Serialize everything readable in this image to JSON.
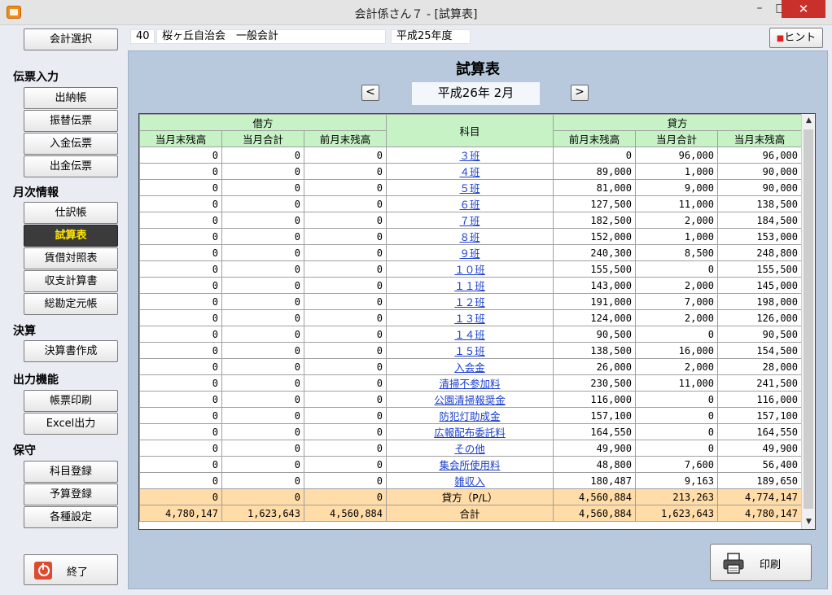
{
  "window": {
    "title": "会計係さん７ - [試算表]",
    "min": "–",
    "max": "□",
    "close": "✕"
  },
  "header": {
    "org_code": "40",
    "org_name": "桜ヶ丘自治会　一般会計",
    "fiscal_year": "平成25年度",
    "hint_label": "ヒント"
  },
  "sidebar": {
    "select_label": "会計選択",
    "sections": {
      "voucher": "伝票入力",
      "monthly": "月次情報",
      "settlement": "決算",
      "output": "出力機能",
      "maintenance": "保守"
    },
    "buttons": {
      "cashbook": "出納帳",
      "transfer": "振替伝票",
      "deposit": "入金伝票",
      "withdrawal": "出金伝票",
      "journal": "仕訳帳",
      "trial_balance": "試算表",
      "balance_sheet": "賃借対照表",
      "income_statement": "収支計算書",
      "general_ledger": "総勘定元帳",
      "make_report": "決算書作成",
      "print_forms": "帳票印刷",
      "excel_output": "Excel出力",
      "account_register": "科目登録",
      "budget_register": "予算登録",
      "settings": "各種設定",
      "exit": "終了"
    }
  },
  "main": {
    "title": "試算表",
    "prev": "<",
    "next": ">",
    "period": "平成26年 2月",
    "print_label": "印刷"
  },
  "table": {
    "debit_header": "借方",
    "account_header": "科目",
    "credit_header": "貸方",
    "cols": {
      "cur_balance": "当月末残高",
      "cur_total": "当月合計",
      "prev_balance": "前月末残高"
    },
    "rows": [
      [
        "0",
        "0",
        "0",
        "３班",
        "0",
        "96,000",
        "96,000"
      ],
      [
        "0",
        "0",
        "0",
        "４班",
        "89,000",
        "1,000",
        "90,000"
      ],
      [
        "0",
        "0",
        "0",
        "５班",
        "81,000",
        "9,000",
        "90,000"
      ],
      [
        "0",
        "0",
        "0",
        "６班",
        "127,500",
        "11,000",
        "138,500"
      ],
      [
        "0",
        "0",
        "0",
        "７班",
        "182,500",
        "2,000",
        "184,500"
      ],
      [
        "0",
        "0",
        "0",
        "８班",
        "152,000",
        "1,000",
        "153,000"
      ],
      [
        "0",
        "0",
        "0",
        "９班",
        "240,300",
        "8,500",
        "248,800"
      ],
      [
        "0",
        "0",
        "0",
        "１０班",
        "155,500",
        "0",
        "155,500"
      ],
      [
        "0",
        "0",
        "0",
        "１１班",
        "143,000",
        "2,000",
        "145,000"
      ],
      [
        "0",
        "0",
        "0",
        "１２班",
        "191,000",
        "7,000",
        "198,000"
      ],
      [
        "0",
        "0",
        "0",
        "１３班",
        "124,000",
        "2,000",
        "126,000"
      ],
      [
        "0",
        "0",
        "0",
        "１４班",
        "90,500",
        "0",
        "90,500"
      ],
      [
        "0",
        "0",
        "0",
        "１５班",
        "138,500",
        "16,000",
        "154,500"
      ],
      [
        "0",
        "0",
        "0",
        "入会金",
        "26,000",
        "2,000",
        "28,000"
      ],
      [
        "0",
        "0",
        "0",
        "清掃不参加料",
        "230,500",
        "11,000",
        "241,500"
      ],
      [
        "0",
        "0",
        "0",
        "公園清掃報奨金",
        "116,000",
        "0",
        "116,000"
      ],
      [
        "0",
        "0",
        "0",
        "防犯灯助成金",
        "157,100",
        "0",
        "157,100"
      ],
      [
        "0",
        "0",
        "0",
        "広報配布委託料",
        "164,550",
        "0",
        "164,550"
      ],
      [
        "0",
        "0",
        "0",
        "その他",
        "49,900",
        "0",
        "49,900"
      ],
      [
        "0",
        "0",
        "0",
        "集会所使用料",
        "48,800",
        "7,600",
        "56,400"
      ],
      [
        "0",
        "0",
        "0",
        "雑収入",
        "180,487",
        "9,163",
        "189,650"
      ]
    ],
    "summary": [
      [
        "0",
        "0",
        "0",
        "貸方（P/L）",
        "4,560,884",
        "213,263",
        "4,774,147"
      ],
      [
        "4,780,147",
        "1,623,643",
        "4,560,884",
        "合計",
        "4,560,884",
        "1,623,643",
        "4,780,147"
      ]
    ]
  },
  "colors": {
    "panel": "#b8c9de",
    "header_green": "#c6f2c6",
    "summary_orange": "#ffdca8",
    "active_button": "#3b3b3b",
    "active_text": "#ffe600",
    "link_blue": "#1a3ecc"
  }
}
